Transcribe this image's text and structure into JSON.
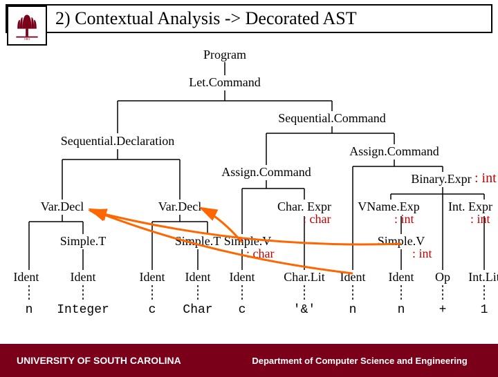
{
  "title": "2) Contextual Analysis -> Decorated AST",
  "footer_left": "UNIVERSITY OF SOUTH CAROLINA",
  "footer_right": "Department of Computer Science and Engineering",
  "nodes": {
    "program": "Program",
    "letcmd": "Let.Command",
    "seqcmd": "Sequential.Command",
    "seqdecl": "Sequential.Declaration",
    "assign1": "Assign.Command",
    "assign2": "Assign.Command",
    "binexpr": "Binary.Expr",
    "vardecl1": "Var.Decl",
    "vardecl2": "Var.Decl",
    "charexpr": "Char. Expr",
    "vnameexp": "VName.Exp",
    "intexpr": "Int. Expr",
    "simplet1": "Simple.T",
    "simplet2": "Simple.T",
    "simplev1": "Simple.V",
    "simplev2": "Simple.V",
    "ident": "Ident",
    "charlit": "Char.Lit",
    "op": "Op",
    "intlit": "Int.Lit"
  },
  "leaves": {
    "n": "n",
    "Integer": "Integer",
    "c": "c",
    "Char": "Char",
    "amp": "'&'",
    "plus": "+",
    "one": "1"
  },
  "annotations": {
    "tint": ": int",
    "tchar": ": char"
  }
}
